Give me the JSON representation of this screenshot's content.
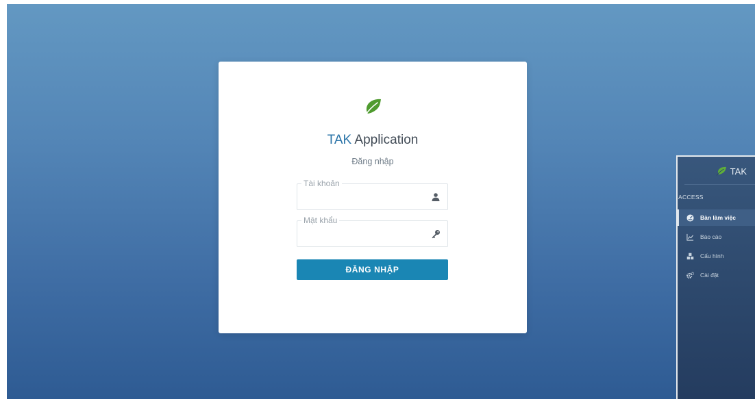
{
  "login": {
    "brand": "TAK",
    "app_name": "Application",
    "subtitle": "Đăng nhập",
    "username": {
      "label": "Tài khoản",
      "value": ""
    },
    "password": {
      "label": "Mật khẩu",
      "value": ""
    },
    "submit_label": "ĐĂNG NHẬP"
  },
  "sidebar": {
    "brand": "TAK",
    "section_label": "ACCESS",
    "items": [
      {
        "label": "Bàn làm việc",
        "icon": "dashboard-icon",
        "active": true
      },
      {
        "label": "Báo cáo",
        "icon": "line-chart-icon",
        "active": false
      },
      {
        "label": "Cấu hình",
        "icon": "cubes-icon",
        "active": false
      },
      {
        "label": "Cài đặt",
        "icon": "gears-icon",
        "active": false
      }
    ]
  },
  "colors": {
    "accent": "#1a86b4",
    "brand_text": "#2b74a8",
    "leaf_green": "#4f9b2f",
    "sidebar_bg": "#2c476b"
  }
}
